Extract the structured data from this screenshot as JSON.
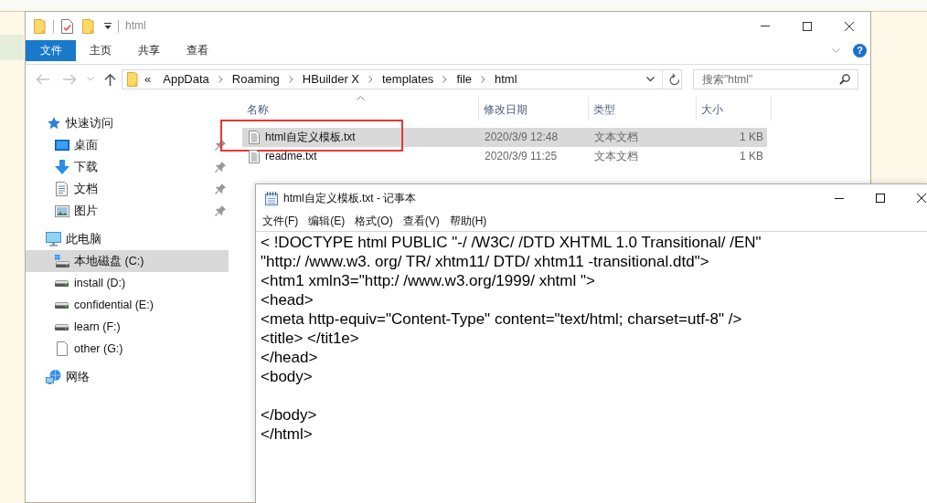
{
  "explorer": {
    "title": "html",
    "ribbon": [
      {
        "label": "文件",
        "kind": "file_menu"
      },
      {
        "label": "主页",
        "kind": "tab"
      },
      {
        "label": "共享",
        "kind": "tab"
      },
      {
        "label": "查看",
        "kind": "tab"
      }
    ],
    "help": "?",
    "address": {
      "overflow": "«",
      "crumbs": [
        "AppData",
        "Roaming",
        "HBuilder X",
        "templates",
        "file",
        "html"
      ]
    },
    "search": {
      "placeholder": "搜索\"html\""
    },
    "nav": [
      {
        "label": "快速访问",
        "kind": "quick_access",
        "selected": false,
        "children": [
          {
            "label": "桌面",
            "kind": "desktop",
            "pinned": true,
            "selected": false
          },
          {
            "label": "下载",
            "kind": "downloads",
            "pinned": true,
            "selected": false
          },
          {
            "label": "文档",
            "kind": "documents",
            "pinned": true,
            "selected": false
          },
          {
            "label": "图片",
            "kind": "pictures",
            "pinned": true,
            "selected": false
          }
        ]
      },
      {
        "label": "此电脑",
        "kind": "computer",
        "selected": false,
        "children": [
          {
            "label": "本地磁盘 (C:)",
            "kind": "system_drive",
            "selected": true
          },
          {
            "label": "install (D:)",
            "kind": "drive",
            "selected": false
          },
          {
            "label": "confidential (E:)",
            "kind": "drive",
            "selected": false
          },
          {
            "label": "learn (F:)",
            "kind": "drive",
            "selected": false
          },
          {
            "label": "other (G:)",
            "kind": "blank_drive",
            "selected": false
          }
        ]
      },
      {
        "label": "网络",
        "kind": "network",
        "selected": false
      }
    ],
    "columns": [
      {
        "label": "名称",
        "sorted": true
      },
      {
        "label": "修改日期",
        "sorted": false
      },
      {
        "label": "类型",
        "sorted": false
      },
      {
        "label": "大小",
        "sorted": false
      }
    ],
    "files": [
      {
        "name": "html自定义模板.txt",
        "modified": "2020/3/9 12:48",
        "type": "文本文档",
        "size": "1 KB",
        "selected": true,
        "highlighted": true
      },
      {
        "name": "readme.txt",
        "modified": "2020/3/9 11:25",
        "type": "文本文档",
        "size": "1 KB",
        "selected": false,
        "highlighted": false
      }
    ]
  },
  "notepad": {
    "title": "html自定义模板.txt - 记事本",
    "menu": [
      "文件(F)",
      "编辑(E)",
      "格式(O)",
      "查看(V)",
      "帮助(H)"
    ],
    "text": "< !DOCTYPE html PUBLIC \"-/ /W3C/ /DTD XHTML 1.0 Transitional/ /EN\"\n\"http:/ /www.w3. org/ TR/ xhtm11/ DTD/ xhtm11 -transitional.dtd\">\n<htm1 xmln3=\"http:/ /www.w3.org/1999/ xhtml \">\n<head>\n<meta http-equiv=\"Content-Type\" content=\"text/html; charset=utf-8\" />\n<title> </tit1e>\n</head>\n<body>\n\n</body>\n</html>"
  }
}
